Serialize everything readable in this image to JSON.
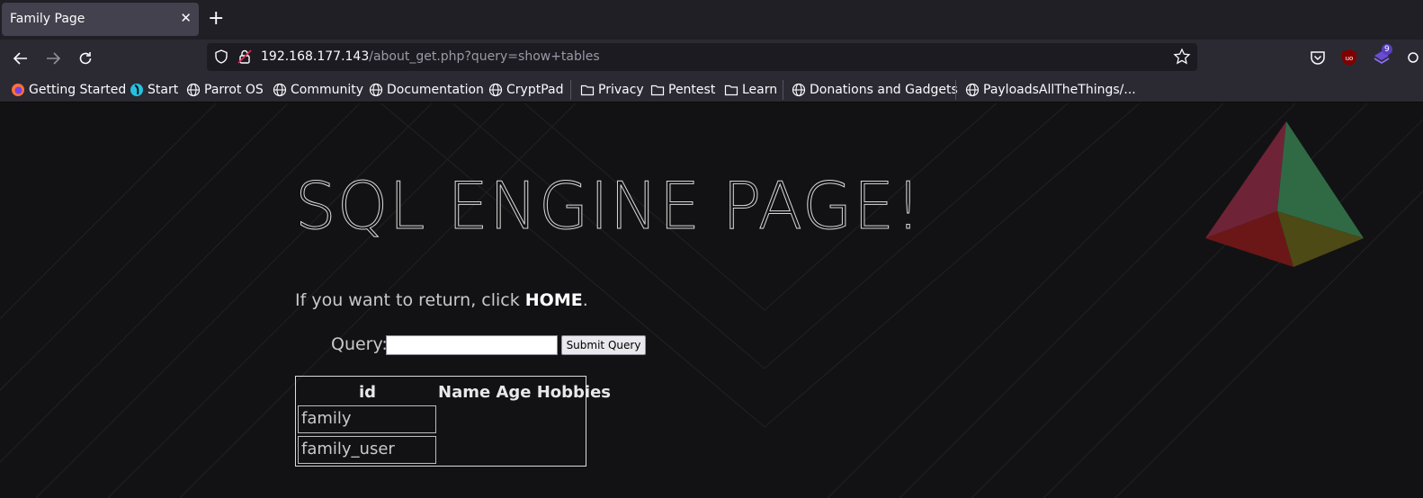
{
  "browser": {
    "tab_title": "Family Page",
    "tab_close": "✕",
    "new_tab": "+",
    "url_host": "192.168.177.143",
    "url_path": "/about_get.php?query=show+tables",
    "extension_badge": "9"
  },
  "bookmarks": [
    {
      "label": "Getting Started",
      "icon": "firefox-icon"
    },
    {
      "label": "Start",
      "icon": "parrot-icon"
    },
    {
      "label": "Parrot OS",
      "icon": "globe-icon"
    },
    {
      "label": "Community",
      "icon": "globe-icon"
    },
    {
      "label": "Documentation",
      "icon": "globe-icon"
    },
    {
      "label": "CryptPad",
      "icon": "globe-icon"
    },
    {
      "label": "Privacy",
      "icon": "folder-icon"
    },
    {
      "label": "Pentest",
      "icon": "folder-icon"
    },
    {
      "label": "Learn",
      "icon": "folder-icon"
    },
    {
      "label": "Donations and Gadgets",
      "icon": "globe-icon"
    },
    {
      "label": "PayloadsAllTheThings/...",
      "icon": "globe-icon"
    }
  ],
  "page": {
    "heading": "SQL ENGINE PAGE!",
    "return_prefix": "If you want to return, click ",
    "return_link": "HOME",
    "return_suffix": ".",
    "query_label": "Query:",
    "query_value": "",
    "submit_label": "Submit Query",
    "table": {
      "headers": [
        "id",
        "Name Age Hobbies"
      ],
      "rows": [
        [
          "family"
        ],
        [
          "family_user"
        ]
      ]
    }
  },
  "colors": {
    "page_bg": "#121214",
    "chrome_bg": "#2b2a33",
    "tabbar_bg": "#1f1f25"
  }
}
